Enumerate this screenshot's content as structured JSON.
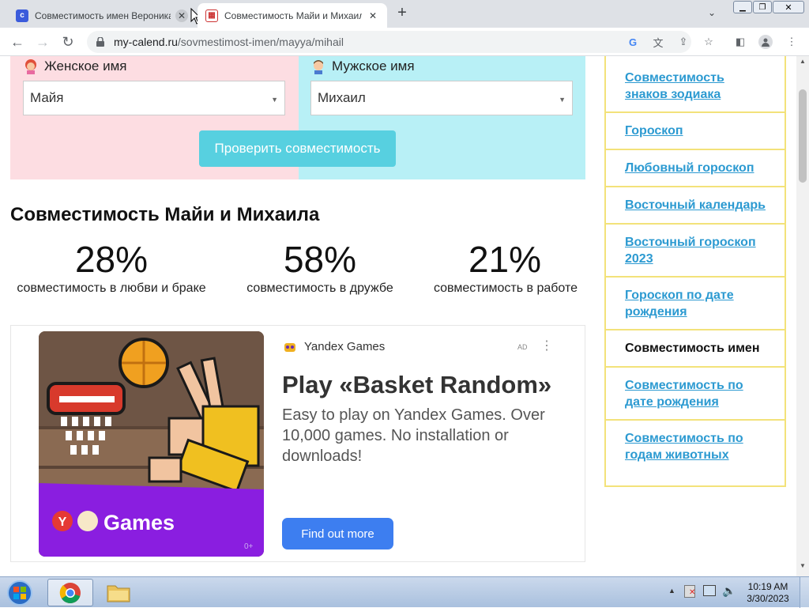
{
  "browser": {
    "tabs": [
      {
        "title": "Совместимость имен Вероника",
        "active": false
      },
      {
        "title": "Совместимость Майи и Михаил",
        "active": true
      }
    ],
    "url_domain": "my-calend.ru",
    "url_path": "/sovmestimost-imen/mayya/mihail"
  },
  "form": {
    "female_label": "Женское имя",
    "female_value": "Майя",
    "male_label": "Мужское имя",
    "male_value": "Михаил",
    "check_button": "Проверить совместимость",
    "colors": {
      "female_bg": "#fddde2",
      "male_bg": "#b8f0f6",
      "button": "#57d0e0"
    }
  },
  "result": {
    "title": "Совместимость Майи и Михаила",
    "items": [
      {
        "percent": "28%",
        "label": "совместимость в любви и браке"
      },
      {
        "percent": "58%",
        "label": "совместимость в дружбе"
      },
      {
        "percent": "21%",
        "label": "совместимость в работе"
      }
    ]
  },
  "ad": {
    "brand": "Yandex Games",
    "mark": "AD",
    "headline": "Play «Basket Random»",
    "body": "Easy to play on Yandex Games. Over 10,000 games. No installation or downloads!",
    "cta": "Find out more",
    "image_caption": "Games",
    "age": "0+"
  },
  "sidebar": {
    "items": [
      {
        "label": "Совместимость знаков зодиака",
        "current": false
      },
      {
        "label": "Гороскоп",
        "current": false
      },
      {
        "label": "Любовный гороскоп",
        "current": false
      },
      {
        "label": "Восточный календарь",
        "current": false
      },
      {
        "label": "Восточный гороскоп 2023",
        "current": false
      },
      {
        "label": "Гороскоп по дате рождения",
        "current": false
      },
      {
        "label": "Совместимость имен",
        "current": true
      },
      {
        "label": "Совместимость по дате рождения",
        "current": false
      },
      {
        "label": "Совместимость по годам животных",
        "current": false
      }
    ],
    "color_border": "#f3e27a",
    "color_link": "#2c9ad1"
  },
  "taskbar": {
    "time": "10:19 AM",
    "date": "3/30/2023"
  }
}
